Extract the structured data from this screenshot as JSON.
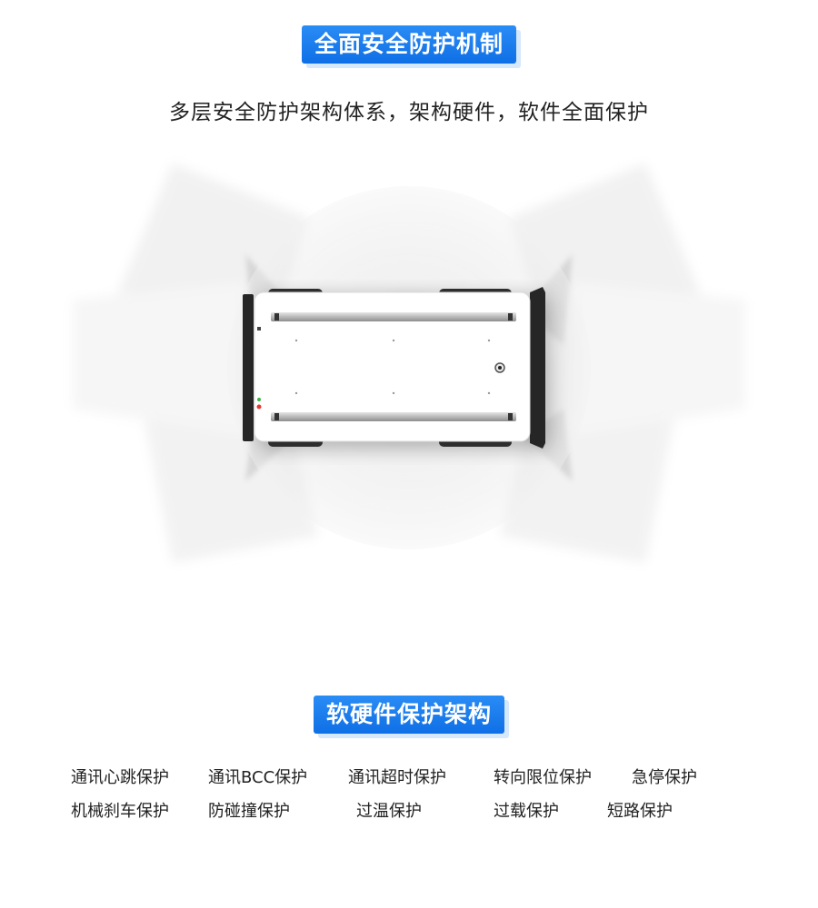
{
  "section1": {
    "title": "全面安全防护机制",
    "subtitle": "多层安全防护架构体系，架构硬件，软件全面保护"
  },
  "section2": {
    "title": "软硬件保护架构",
    "features_row1": [
      "通讯心跳保护",
      "通讯BCC保护",
      "通讯超时保护",
      "转向限位保护",
      "急停保护"
    ],
    "features_row2": [
      "机械刹车保护",
      "防碰撞保护",
      "过温保护",
      "过载保护",
      "短路保护"
    ]
  },
  "colors": {
    "accent": "#1677ee",
    "indicator_green": "#3cb54a",
    "indicator_red": "#e53935"
  },
  "image": {
    "subject": "robot-chassis-top-view"
  }
}
